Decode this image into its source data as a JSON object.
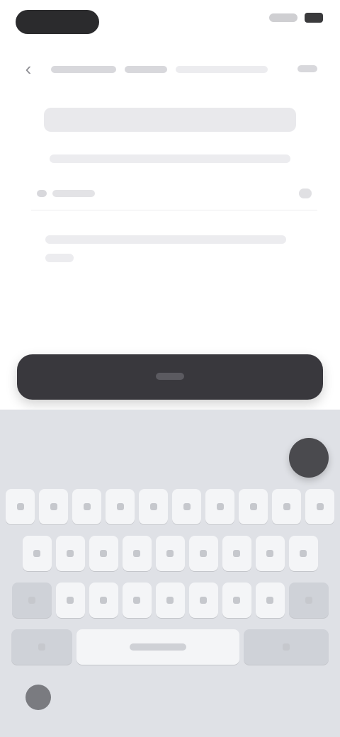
{
  "status_bar": {
    "time": "",
    "indicators": "signal-wifi-battery"
  },
  "nav": {
    "back_icon": "chevron-left-icon",
    "menu_icon": "more-icon"
  },
  "form": {
    "title": "",
    "subtitle": "",
    "field_placeholder": "",
    "help_text": ""
  },
  "primary_button": {
    "label": ""
  },
  "keyboard": {
    "row1": [
      "",
      "",
      "",
      "",
      "",
      "",
      "",
      "",
      ""
    ],
    "row2": [
      "",
      "",
      "",
      "",
      "",
      "",
      "",
      "",
      ""
    ],
    "row3": [
      "",
      "",
      "",
      "",
      "",
      "",
      "",
      ""
    ],
    "space_label": "",
    "mic_icon": "mic-icon",
    "globe_icon": "globe-icon"
  },
  "colors": {
    "button_bg": "#39383d",
    "keyboard_bg": "#dfe1e6",
    "key_bg": "#f4f5f7"
  }
}
